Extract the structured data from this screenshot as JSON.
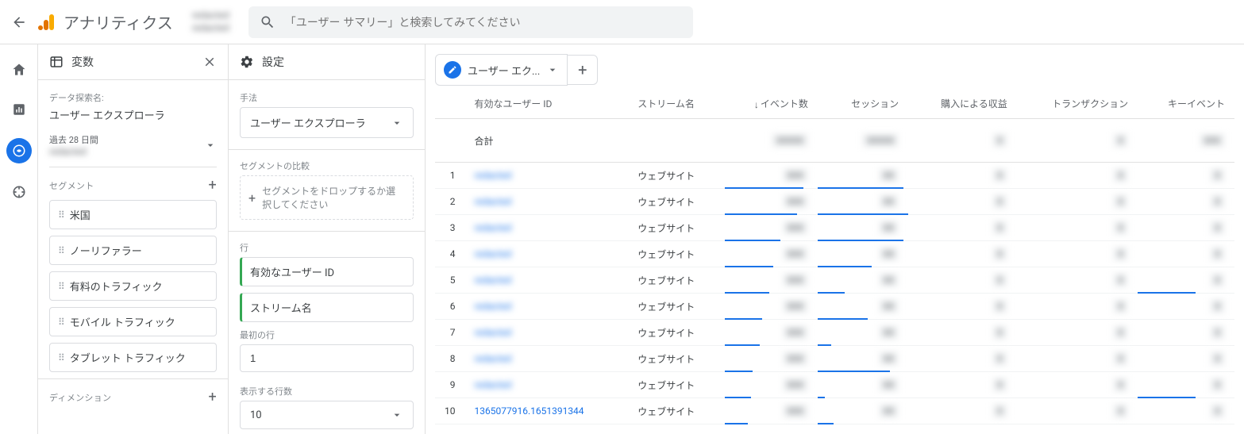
{
  "header": {
    "product": "アナリティクス",
    "property_line1": "redacted",
    "property_line2": "redacted",
    "search_placeholder": "「ユーザー サマリー」と検索してみてください"
  },
  "vars_panel": {
    "title": "変数",
    "exploration_name_label": "データ探索名:",
    "exploration_name": "ユーザー エクスプローラ",
    "date_preset": "過去 28 日間",
    "date_range": "redacted",
    "segments_label": "セグメント",
    "segments": [
      "米国",
      "ノーリファラー",
      "有料のトラフィック",
      "モバイル トラフィック",
      "タブレット トラフィック"
    ],
    "dimensions_label": "ディメンション"
  },
  "settings_panel": {
    "title": "設定",
    "technique_label": "手法",
    "technique": "ユーザー エクスプローラ",
    "segment_compare_label": "セグメントの比較",
    "segment_drop_hint": "セグメントをドロップするか選択してください",
    "rows_label": "行",
    "row_chips": [
      "有効なユーザー ID",
      "ストリーム名"
    ],
    "first_row_label": "最初の行",
    "first_row_value": "1",
    "rows_shown_label": "表示する行数",
    "rows_shown_value": "10"
  },
  "report": {
    "tab_label": "ユーザー エク...",
    "columns": {
      "user_id": "有効なユーザー ID",
      "stream": "ストリーム名",
      "events": "イベント数",
      "sessions": "セッション",
      "revenue": "購入による収益",
      "transactions": "トランザクション",
      "key_events": "キーイベント"
    },
    "total_label": "合計",
    "rows": [
      {
        "idx": 1,
        "user_id": "redacted",
        "stream": "ウェブサイト",
        "bars": [
          85,
          95
        ]
      },
      {
        "idx": 2,
        "user_id": "redacted",
        "stream": "ウェブサイト",
        "bars": [
          78,
          100
        ]
      },
      {
        "idx": 3,
        "user_id": "redacted",
        "stream": "ウェブサイト",
        "bars": [
          60,
          95
        ]
      },
      {
        "idx": 4,
        "user_id": "redacted",
        "stream": "ウェブサイト",
        "bars": [
          52,
          60
        ]
      },
      {
        "idx": 5,
        "user_id": "redacted",
        "stream": "ウェブサイト",
        "bars": [
          48,
          30
        ]
      },
      {
        "idx": 6,
        "user_id": "redacted",
        "stream": "ウェブサイト",
        "bars": [
          40,
          55
        ]
      },
      {
        "idx": 7,
        "user_id": "redacted",
        "stream": "ウェブサイト",
        "bars": [
          38,
          15
        ]
      },
      {
        "idx": 8,
        "user_id": "redacted",
        "stream": "ウェブサイト",
        "bars": [
          30,
          80
        ]
      },
      {
        "idx": 9,
        "user_id": "redacted",
        "stream": "ウェブサイト",
        "bars": [
          28,
          8
        ]
      },
      {
        "idx": 10,
        "user_id": "1365077916.1651391344",
        "stream": "ウェブサイト",
        "bars": [
          25,
          18
        ]
      }
    ]
  }
}
